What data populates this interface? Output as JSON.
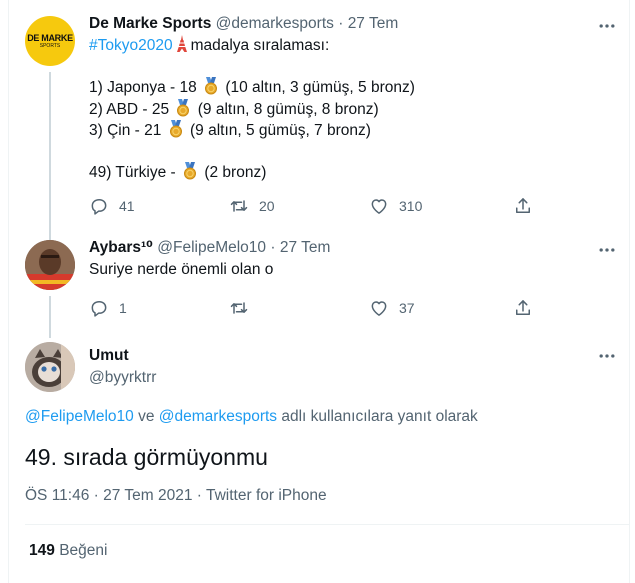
{
  "colors": {
    "accent": "#1d9bf0",
    "muted": "#536471",
    "thread_line": "#cfd9de",
    "medal_gold": "#e8a92a",
    "medal_ribbon": "#4f8fd8",
    "demarke_bg": "#f6c90e"
  },
  "tweet1": {
    "display_name": "De Marke Sports",
    "handle": "@demarkesports",
    "sep": "·",
    "date": "27 Tem",
    "avatar_logo": {
      "line1": "DE MARKE",
      "line2": "SPORTS"
    },
    "hashtag": "#Tokyo2020",
    "line1_tail": "madalya sıralaması:",
    "r1_a": "1) Japonya - 18",
    "r1_b": "(10 altın, 3 gümüş, 5 bronz)",
    "r2_a": "2) ABD - 25",
    "r2_b": "(9 altın, 8 gümüş, 8 bronz)",
    "r3_a": "3) Çin - 21",
    "r3_b": "(9 altın, 5 gümüş, 7 bronz)",
    "r49_a": "49) Türkiye -",
    "r49_b": "(2 bronz)",
    "replies": "41",
    "retweets": "20",
    "likes": "310"
  },
  "tweet2": {
    "display_name": "Aybars¹⁰",
    "handle": "@FelipeMelo10",
    "sep": "·",
    "date": "27 Tem",
    "text": "Suriye nerde önemli olan o",
    "replies": "1",
    "retweets": "",
    "likes": "37"
  },
  "main": {
    "display_name": "Umut",
    "handle": "@byyrktrr",
    "reply_mention1": "@FelipeMelo10",
    "reply_and": "ve",
    "reply_mention2": "@demarkesports",
    "reply_tail": "adlı kullanıcılara yanıt olarak",
    "text": "49. sırada görmüyonmu",
    "time": "ÖS 11:46",
    "dot1": "·",
    "date": "27 Tem 2021",
    "dot2": "·",
    "source": "Twitter for iPhone",
    "likes_count": "149",
    "likes_label": "Beğeni"
  },
  "icons": [
    "more-icon",
    "reply-icon",
    "retweet-icon",
    "like-icon",
    "share-icon",
    "medal-icon",
    "tokyo-tower-icon"
  ]
}
